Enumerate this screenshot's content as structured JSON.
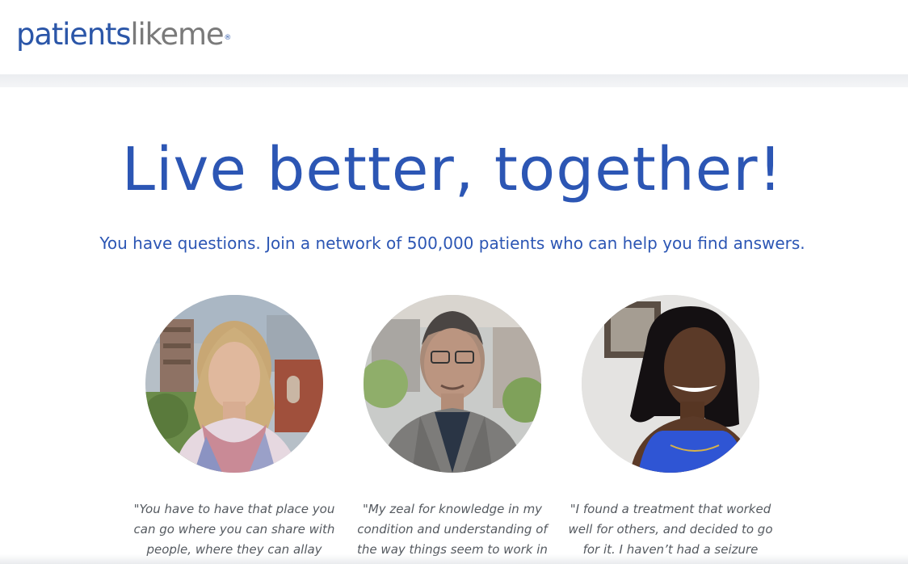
{
  "logo": {
    "part1": "patients",
    "part2": "likeme",
    "mark": "®"
  },
  "hero": {
    "headline": "Live better, together!",
    "subline": "You have questions. Join a network of 500,000 patients who can help you find answers."
  },
  "testimonials": [
    {
      "avatar": "woman-blonde-scarf",
      "quote": "\"You have to have that place you can go where you can share with people, where they can allay"
    },
    {
      "avatar": "man-glasses-blazer",
      "quote": "\"My zeal for knowledge in my condition and understanding of the way things seem to work in"
    },
    {
      "avatar": "woman-blue-top",
      "quote": "\"I found a treatment that worked well for others, and decided to go for it. I haven’t had a seizure"
    }
  ],
  "colors": {
    "brand_blue": "#2c56b4",
    "logo_gray": "#7a7a7a",
    "quote_gray": "#555a60"
  }
}
